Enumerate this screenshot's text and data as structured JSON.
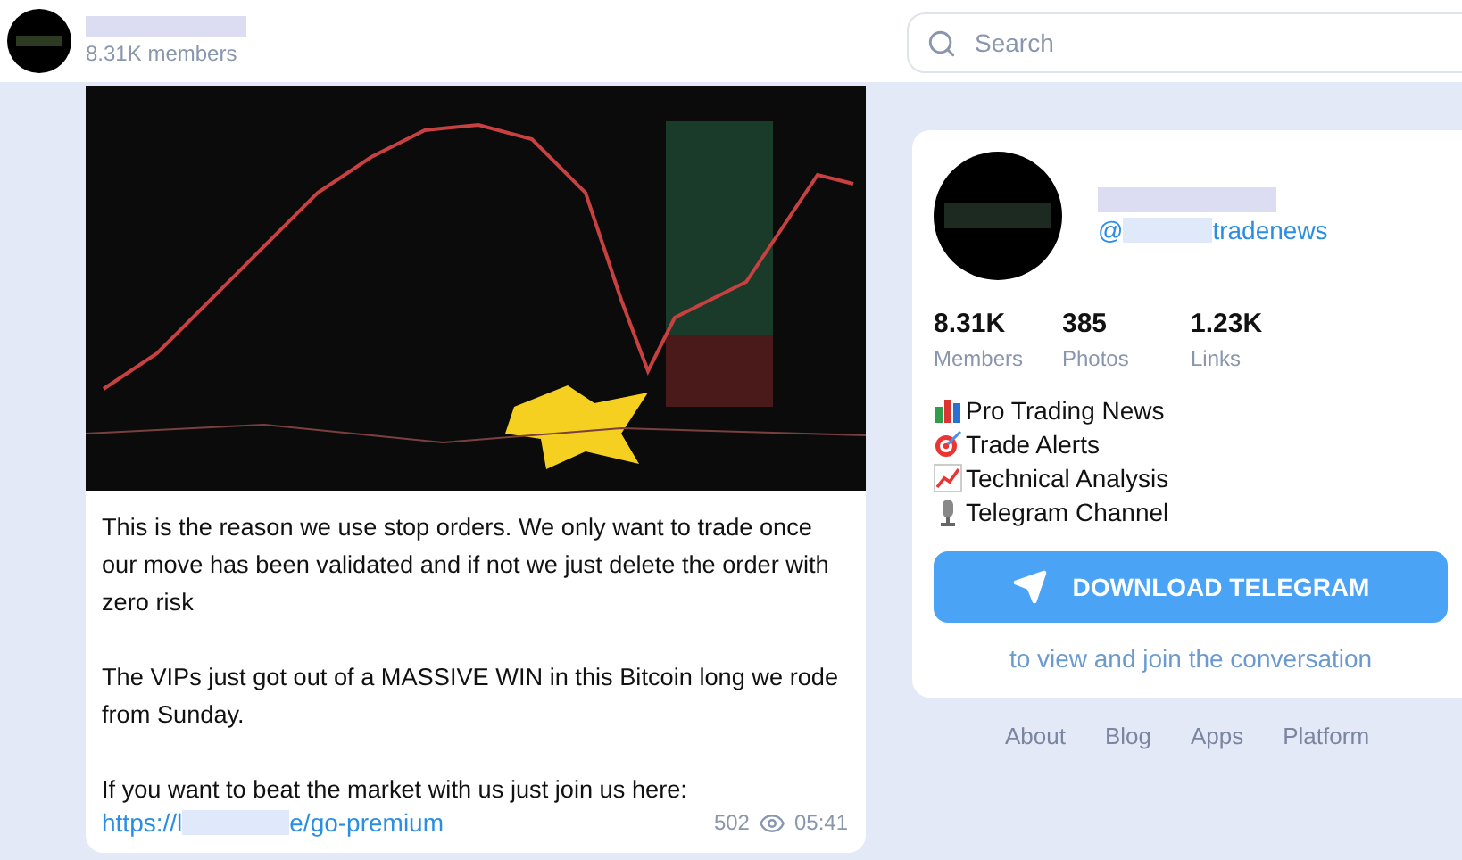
{
  "header": {
    "members": "8.31K members"
  },
  "search": {
    "placeholder": "Search"
  },
  "message": {
    "paragraphs": [
      "This is the reason we use stop orders. We only want to trade once our move has been validated and if not we just delete the order with zero risk",
      "The VIPs just got out of a MASSIVE WIN in this Bitcoin long we rode from Sunday.",
      "If you want to beat the market with us just join us here:"
    ],
    "link": {
      "prefix": "https://l",
      "suffix": "e/go-premium"
    },
    "views": "502",
    "time": "05:41"
  },
  "channel": {
    "handle": {
      "prefix": "@",
      "suffix": "tradenews"
    },
    "stats": [
      {
        "value": "8.31K",
        "label": "Members"
      },
      {
        "value": "385",
        "label": "Photos"
      },
      {
        "value": "1.23K",
        "label": "Links"
      }
    ],
    "description": [
      {
        "kind": "chart",
        "text": "Pro Trading News"
      },
      {
        "kind": "target",
        "text": "Trade Alerts"
      },
      {
        "kind": "trend",
        "text": "Technical Analysis"
      },
      {
        "kind": "mic",
        "text": "Telegram Channel"
      }
    ],
    "button": "DOWNLOAD TELEGRAM",
    "hint": "to view and join the conversation"
  },
  "footer": [
    "About",
    "Blog",
    "Apps",
    "Platform"
  ]
}
